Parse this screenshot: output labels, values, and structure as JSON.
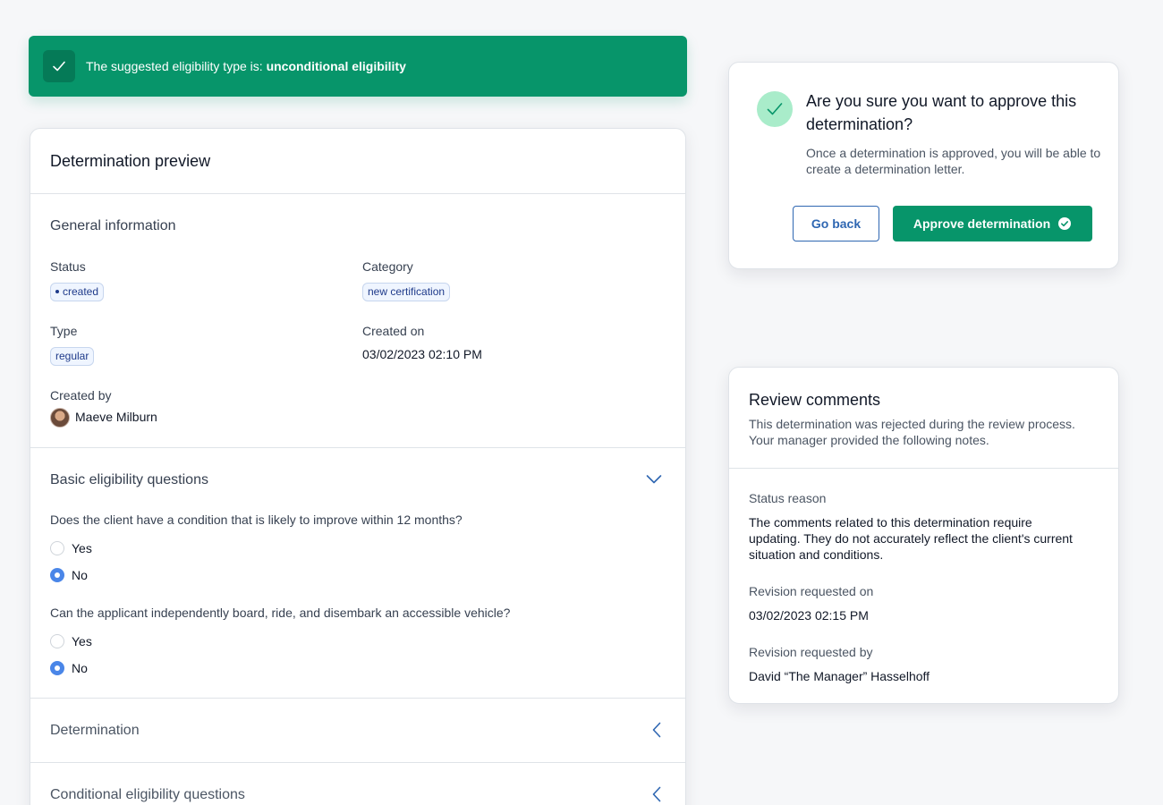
{
  "banner": {
    "prefix": "The suggested eligibility type is: ",
    "value": "unconditional eligibility",
    "icon": "check-icon",
    "color": "#07956a"
  },
  "determination_preview": {
    "title": "Determination preview",
    "general": {
      "title": "General information",
      "status_label": "Status",
      "status_value": "created",
      "category_label": "Category",
      "category_value": "new certification",
      "type_label": "Type",
      "type_value": "regular",
      "created_on_label": "Created on",
      "created_on_value": "03/02/2023 02:10 PM",
      "created_by_label": "Created by",
      "created_by_value": "Maeve Milburn"
    },
    "basic": {
      "title": "Basic eligibility questions",
      "questions": [
        {
          "text": "Does the client have a condition that is likely to improve within 12 months?",
          "options": [
            "Yes",
            "No"
          ],
          "selected": "No"
        },
        {
          "text": "Can the applicant independently board, ride, and disembark an accessible vehicle?",
          "options": [
            "Yes",
            "No"
          ],
          "selected": "No"
        }
      ]
    },
    "collapsed_sections": [
      "Determination",
      "Conditional eligibility questions"
    ]
  },
  "approve_dialog": {
    "title": "Are you sure you want to approve this determination?",
    "description": "Once a determination is approved, you will be able to create a determination letter.",
    "back_label": "Go back",
    "approve_label": "Approve determination"
  },
  "review_comments": {
    "title": "Review comments",
    "description": "This determination was rejected during the review process. Your manager provided the following notes.",
    "status_reason_label": "Status reason",
    "status_reason_value": "The comments related to this determination require updating. They do not accurately reflect the client's current situation and conditions.",
    "revision_on_label": "Revision requested on",
    "revision_on_value": "03/02/2023 02:15 PM",
    "revision_by_label": "Revision requested by",
    "revision_by_value": "David “The Manager” Hasselhoff"
  }
}
